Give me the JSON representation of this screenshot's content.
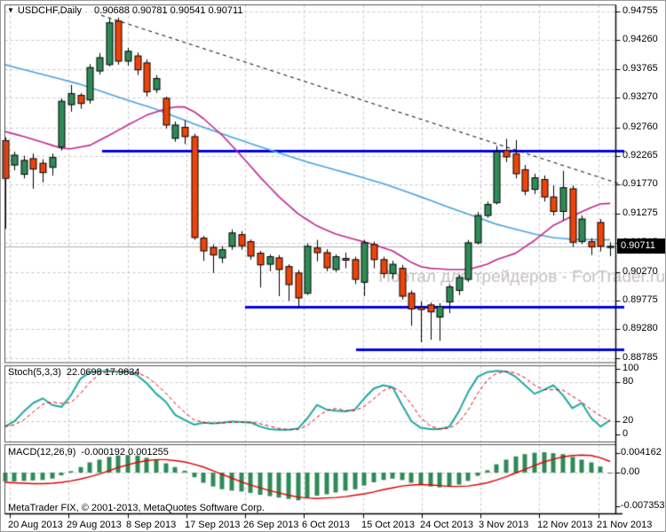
{
  "header": {
    "collapse_glyph": "▼",
    "symbol": "USDCHF,Daily",
    "ohlc": "0.90688 0.90781 0.90541 0.90711"
  },
  "watermark": {
    "text": "Портал для трейдеров - ForTrader.ru"
  },
  "footer": {
    "copyright": "MetaTrader FIX, © 2001-2013, MetaQuotes Software Corp."
  },
  "price_axis": {
    "current_price": "0.90711",
    "labels": [
      "0.94755",
      "0.94260",
      "0.93765",
      "0.93270",
      "0.92760",
      "0.92265",
      "0.91770",
      "0.91275",
      "0.90765",
      "0.90270",
      "0.89775",
      "0.89280",
      "0.88785"
    ],
    "label_step": 0.00495
  },
  "date_axis": {
    "labels": [
      "20 Aug 2013",
      "29 Aug 2013",
      "8 Sep 2013",
      "17 Sep 2013",
      "26 Sep 2013",
      "6 Oct 2013",
      "15 Oct 2013",
      "24 Oct 2013",
      "3 Nov 2013",
      "12 Nov 2013",
      "21 Nov 2013"
    ]
  },
  "indicators": {
    "stoch": {
      "name": "Stoch(5,3,3)",
      "values": "22.0698 17.9834",
      "axis_labels": [
        {
          "v": 100,
          "t": "100"
        },
        {
          "v": 80,
          "t": "80"
        },
        {
          "v": 20,
          "t": "20"
        },
        {
          "v": 0,
          "t": "0"
        }
      ],
      "grid_levels": [
        80,
        20
      ]
    },
    "macd": {
      "name": "MACD(12,26,9)",
      "values": "-0.000192 0.001255",
      "axis_labels": [
        {
          "v": 0.004162,
          "t": "0.004162"
        },
        {
          "v": 0,
          "t": "0.00"
        },
        {
          "v": -0.007353,
          "t": "-0.007353"
        }
      ],
      "grid_levels": [
        0
      ]
    }
  },
  "colors": {
    "background": "#ffffff",
    "grid": "#c6c6c6",
    "bull": "#2e8b57",
    "bear": "#ee4409",
    "candle_border": "#000000",
    "ma_cyan": "#4aa3e0",
    "ma_magenta": "#c2278f",
    "hline_blue": "#0000ee",
    "trendline": "#000000",
    "stoch_main": "#20a8a0",
    "stoch_signal": "#e00000",
    "macd_hist": "#2e8b57",
    "macd_signal": "#e00000",
    "price_line": "#b0b0b0",
    "price_box_bg": "#000000",
    "price_box_fg": "#ffffff",
    "watermark": "#c9c0c0",
    "panel_border": "#555555",
    "axis": "#000000",
    "text": "#000000"
  },
  "chart_data": [
    {
      "type": "candlestick",
      "title": "USDCHF,Daily",
      "timeframe": "Daily",
      "ylim": [
        0.8871,
        0.9488
      ],
      "ohlc": [
        [
          0.9253,
          0.9259,
          0.9101,
          0.9188
        ],
        [
          0.9211,
          0.9234,
          0.9202,
          0.9228
        ],
        [
          0.9195,
          0.9227,
          0.9188,
          0.9219
        ],
        [
          0.9222,
          0.9231,
          0.917,
          0.9204
        ],
        [
          0.9214,
          0.9221,
          0.9181,
          0.9198
        ],
        [
          0.9207,
          0.9231,
          0.9193,
          0.9224
        ],
        [
          0.9242,
          0.9326,
          0.9236,
          0.9321
        ],
        [
          0.9315,
          0.9349,
          0.9303,
          0.9334
        ],
        [
          0.9331,
          0.9335,
          0.9308,
          0.9317
        ],
        [
          0.9323,
          0.9385,
          0.9317,
          0.9379
        ],
        [
          0.9373,
          0.9404,
          0.9367,
          0.9396
        ],
        [
          0.9384,
          0.9463,
          0.9381,
          0.9456
        ],
        [
          0.9459,
          0.9465,
          0.9384,
          0.939
        ],
        [
          0.939,
          0.9413,
          0.9382,
          0.9407
        ],
        [
          0.9399,
          0.9405,
          0.9366,
          0.9375
        ],
        [
          0.9387,
          0.9393,
          0.9329,
          0.9337
        ],
        [
          0.9341,
          0.9366,
          0.9335,
          0.936
        ],
        [
          0.9326,
          0.9329,
          0.9274,
          0.928
        ],
        [
          0.9257,
          0.9286,
          0.9251,
          0.928
        ],
        [
          0.9276,
          0.9288,
          0.9247,
          0.926
        ],
        [
          0.926,
          0.9265,
          0.9082,
          0.9086
        ],
        [
          0.9085,
          0.9089,
          0.9046,
          0.9063
        ],
        [
          0.9069,
          0.9074,
          0.9025,
          0.9056
        ],
        [
          0.9051,
          0.9071,
          0.9042,
          0.9065
        ],
        [
          0.9071,
          0.91,
          0.9065,
          0.9094
        ],
        [
          0.9091,
          0.9097,
          0.9065,
          0.9072
        ],
        [
          0.9079,
          0.9083,
          0.9048,
          0.9054
        ],
        [
          0.9059,
          0.9063,
          0.9,
          0.9039
        ],
        [
          0.904,
          0.9057,
          0.9028,
          0.9053
        ],
        [
          0.9051,
          0.9056,
          0.8985,
          0.9031
        ],
        [
          0.9036,
          0.904,
          0.8977,
          0.9005
        ],
        [
          0.9025,
          0.903,
          0.8964,
          0.8982
        ],
        [
          0.899,
          0.9076,
          0.8987,
          0.9071
        ],
        [
          0.9068,
          0.9082,
          0.9045,
          0.906
        ],
        [
          0.906,
          0.9066,
          0.9028,
          0.9034
        ],
        [
          0.9031,
          0.9057,
          0.9027,
          0.9053
        ],
        [
          0.905,
          0.906,
          0.9033,
          0.9047
        ],
        [
          0.9048,
          0.9053,
          0.9006,
          0.9014
        ],
        [
          0.9009,
          0.9082,
          0.8985,
          0.9077
        ],
        [
          0.9074,
          0.9079,
          0.9033,
          0.9048
        ],
        [
          0.9048,
          0.9053,
          0.9016,
          0.9024
        ],
        [
          0.9024,
          0.9046,
          0.9015,
          0.904
        ],
        [
          0.9033,
          0.9039,
          0.8979,
          0.8985
        ],
        [
          0.899,
          0.8995,
          0.8934,
          0.8963
        ],
        [
          0.8966,
          0.8976,
          0.8906,
          0.8962
        ],
        [
          0.897,
          0.8974,
          0.891,
          0.8958
        ],
        [
          0.8949,
          0.8973,
          0.8908,
          0.8967
        ],
        [
          0.8975,
          0.9005,
          0.8956,
          0.9001
        ],
        [
          0.8995,
          0.9022,
          0.8987,
          0.9017
        ],
        [
          0.9014,
          0.9082,
          0.901,
          0.9077
        ],
        [
          0.9077,
          0.913,
          0.9074,
          0.9124
        ],
        [
          0.9124,
          0.9148,
          0.912,
          0.9143
        ],
        [
          0.9146,
          0.9244,
          0.9143,
          0.9234
        ],
        [
          0.9236,
          0.9256,
          0.9216,
          0.9225
        ],
        [
          0.923,
          0.9254,
          0.9188,
          0.9196
        ],
        [
          0.9203,
          0.9211,
          0.9159,
          0.9166
        ],
        [
          0.9169,
          0.9196,
          0.9161,
          0.9189
        ],
        [
          0.9186,
          0.9193,
          0.9148,
          0.9156
        ],
        [
          0.9156,
          0.9176,
          0.9124,
          0.9131
        ],
        [
          0.9131,
          0.9201,
          0.9116,
          0.9172
        ],
        [
          0.917,
          0.9176,
          0.907,
          0.9078
        ],
        [
          0.9079,
          0.9124,
          0.9075,
          0.9118
        ],
        [
          0.9079,
          0.9085,
          0.9056,
          0.907
        ],
        [
          0.9112,
          0.9118,
          0.9062,
          0.9071
        ],
        [
          0.90688,
          0.90781,
          0.90541,
          0.90711
        ]
      ],
      "overlays": {
        "ma_cyan": {
          "anchors": [
            [
              0,
              0.9384
            ],
            [
              4,
              0.9367
            ],
            [
              8,
              0.935
            ],
            [
              12,
              0.9328
            ],
            [
              16,
              0.9307
            ],
            [
              20,
              0.9282
            ],
            [
              24,
              0.9259
            ],
            [
              28,
              0.9237
            ],
            [
              32,
              0.9216
            ],
            [
              36,
              0.9198
            ],
            [
              40,
              0.9179
            ],
            [
              44,
              0.9156
            ],
            [
              48,
              0.9132
            ],
            [
              52,
              0.9109
            ],
            [
              56,
              0.9092
            ],
            [
              58,
              0.9086
            ],
            [
              60,
              0.9083
            ],
            [
              64,
              0.9082
            ]
          ]
        },
        "ma_magenta": {
          "anchors": [
            [
              0,
              0.9269
            ],
            [
              2,
              0.926
            ],
            [
              4,
              0.925
            ],
            [
              6,
              0.924
            ],
            [
              7,
              0.9239
            ],
            [
              9,
              0.9245
            ],
            [
              11,
              0.9262
            ],
            [
              13,
              0.928
            ],
            [
              15,
              0.9297
            ],
            [
              17,
              0.9308
            ],
            [
              18,
              0.9311
            ],
            [
              19,
              0.9311
            ],
            [
              20,
              0.9303
            ],
            [
              21,
              0.9291
            ],
            [
              23,
              0.9262
            ],
            [
              25,
              0.9227
            ],
            [
              27,
              0.919
            ],
            [
              29,
              0.9156
            ],
            [
              31,
              0.9127
            ],
            [
              33,
              0.9106
            ],
            [
              35,
              0.9092
            ],
            [
              37,
              0.9083
            ],
            [
              39,
              0.9074
            ],
            [
              41,
              0.9063
            ],
            [
              43,
              0.9043
            ],
            [
              44,
              0.9036
            ],
            [
              45,
              0.9033
            ],
            [
              47,
              0.9031
            ],
            [
              49,
              0.9031
            ],
            [
              51,
              0.904
            ],
            [
              52,
              0.9048
            ],
            [
              54,
              0.9059
            ],
            [
              56,
              0.9081
            ],
            [
              58,
              0.9107
            ],
            [
              60,
              0.9123
            ],
            [
              62,
              0.9138
            ],
            [
              63,
              0.9144
            ],
            [
              64,
              0.9145
            ]
          ]
        },
        "trendline": {
          "style": "dashed",
          "points": [
            [
              113,
              0.9469
            ],
            [
              700,
              0.9177
            ]
          ]
        },
        "hlines": [
          {
            "price": 0.9236,
            "x_start": 114
          },
          {
            "price": 0.8967,
            "x_start": 275
          },
          {
            "price": 0.8893,
            "x_start": 400
          }
        ],
        "current_price": 0.90711
      }
    },
    {
      "type": "line",
      "name": "Stochastic(5,3,3)",
      "ylim": [
        0,
        100
      ],
      "levels": [
        80,
        20
      ],
      "k": [
        12,
        20,
        35,
        48,
        55,
        45,
        42,
        60,
        85,
        95,
        96,
        97,
        95,
        96,
        90,
        78,
        62,
        50,
        30,
        22,
        15,
        18,
        17,
        18,
        20,
        19,
        18,
        12,
        8,
        7,
        7,
        9,
        25,
        45,
        38,
        36,
        35,
        38,
        55,
        70,
        75,
        72,
        45,
        20,
        10,
        8,
        8,
        12,
        35,
        65,
        88,
        95,
        97,
        96,
        88,
        75,
        62,
        68,
        75,
        60,
        40,
        48,
        25,
        12,
        22
      ],
      "d_smoothing": 3
    },
    {
      "type": "bar+line",
      "name": "MACD(12,26,9)",
      "ylim": [
        -0.007353,
        0.004162
      ],
      "histogram": [
        -0.0019,
        -0.0019,
        -0.0018,
        -0.0017,
        -0.0016,
        -0.0013,
        -0.0006,
        0.0003,
        0.0012,
        0.0022,
        0.0028,
        0.0034,
        0.0037,
        0.0038,
        0.0037,
        0.0032,
        0.0027,
        0.002,
        0.0012,
        0.0004,
        -0.001,
        -0.0022,
        -0.003,
        -0.0036,
        -0.0039,
        -0.0041,
        -0.0044,
        -0.0048,
        -0.0051,
        -0.0054,
        -0.0057,
        -0.006,
        -0.0055,
        -0.005,
        -0.0047,
        -0.0043,
        -0.0039,
        -0.0036,
        -0.0028,
        -0.0021,
        -0.0016,
        -0.0013,
        -0.0016,
        -0.0022,
        -0.0026,
        -0.003,
        -0.0032,
        -0.003,
        -0.0026,
        -0.0018,
        -0.0007,
        0.0005,
        0.0018,
        0.0028,
        0.0035,
        0.004,
        0.0043,
        0.0044,
        0.0042,
        0.004,
        0.0034,
        0.0028,
        0.0022,
        0.0013,
        -0.0002
      ],
      "signal": [
        -0.0021,
        -0.0022,
        -0.0023,
        -0.0024,
        -0.0024,
        -0.0023,
        -0.0021,
        -0.0018,
        -0.0014,
        -0.0009,
        -0.0003,
        0.0004,
        0.0011,
        0.0017,
        0.0022,
        0.0026,
        0.0028,
        0.0028,
        0.0026,
        0.0023,
        0.0018,
        0.0012,
        0.0004,
        -0.0004,
        -0.0012,
        -0.002,
        -0.0027,
        -0.0033,
        -0.0039,
        -0.0044,
        -0.0049,
        -0.0053,
        -0.0055,
        -0.0056,
        -0.0055,
        -0.0054,
        -0.0052,
        -0.0049,
        -0.0046,
        -0.0042,
        -0.0037,
        -0.0033,
        -0.0029,
        -0.0027,
        -0.0026,
        -0.0027,
        -0.0028,
        -0.003,
        -0.003,
        -0.0029,
        -0.0026,
        -0.0022,
        -0.0016,
        -0.0009,
        -0.0001,
        0.0007,
        0.0015,
        0.0023,
        0.0029,
        0.0034,
        0.0037,
        0.0038,
        0.0037,
        0.0032,
        0.0024
      ]
    }
  ]
}
